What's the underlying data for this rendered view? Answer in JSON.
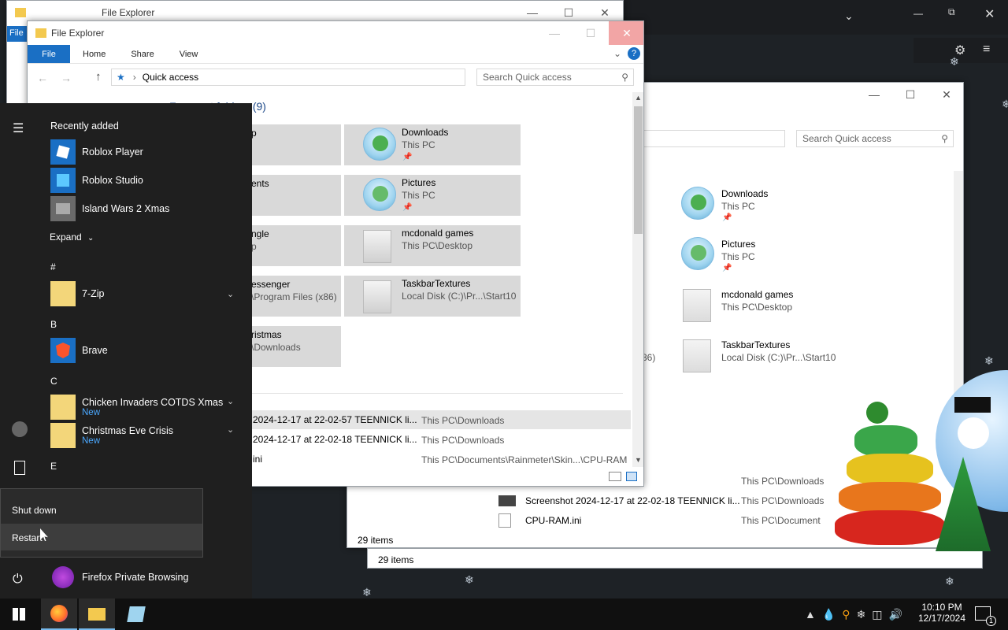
{
  "back_window": {
    "title": "File Explorer",
    "tab_label": "File",
    "status": "29 items"
  },
  "win3": {
    "search_placeholder": "Search Quick access",
    "status": "29 items",
    "tiles": [
      {
        "name": "Downloads",
        "location": "This PC"
      },
      {
        "name": "Pictures",
        "location": "This PC"
      },
      {
        "name": "mcdonald games",
        "location": "This PC\\Desktop"
      },
      {
        "name": "TaskbarTextures",
        "location": "Local Disk (C:)\\Pr...\\Start10"
      }
    ],
    "partial_text": "86)",
    "recent": [
      {
        "name": "2-57 TEENNICK li...",
        "path": "This PC\\Downloads"
      },
      {
        "name": "Screenshot 2024-12-17 at 22-02-18 TEENNICK li...",
        "path": "This PC\\Downloads"
      },
      {
        "name": "CPU-RAM.ini",
        "path": "This PC\\Document"
      }
    ]
  },
  "win2": {
    "status": "29 items"
  },
  "front": {
    "title": "File Explorer",
    "tabs": {
      "file": "File",
      "home": "Home",
      "share": "Share",
      "view": "View"
    },
    "address": "Quick access",
    "search_placeholder": "Search Quick access",
    "section_title": "Frequent folders (9)",
    "tiles_left": [
      {
        "name": "p",
        "location": ""
      },
      {
        "name": "ents",
        "location": ""
      },
      {
        "name": "ngle",
        "location": "p"
      },
      {
        "name": "essenger",
        "location": "\\Program Files (x86)"
      },
      {
        "name": "ristmas",
        "location": "\\Downloads"
      }
    ],
    "tiles_right": [
      {
        "name": "Downloads",
        "location": "This PC"
      },
      {
        "name": "Pictures",
        "location": "This PC"
      },
      {
        "name": "mcdonald games",
        "location": "This PC\\Desktop"
      },
      {
        "name": "TaskbarTextures",
        "location": "Local Disk (C:)\\Pr...\\Start10"
      }
    ],
    "recent": [
      {
        "name": "2024-12-17 at 22-02-57 TEENNICK li...",
        "path": "This PC\\Downloads"
      },
      {
        "name": "2024-12-17 at 22-02-18 TEENNICK li...",
        "path": "This PC\\Downloads"
      },
      {
        "name": "ini",
        "path": "This PC\\Documents\\Rainmeter\\Skin...\\CPU-RAM"
      }
    ]
  },
  "start_menu": {
    "recently_added": "Recently added",
    "apps_recent": [
      {
        "label": "Roblox Player"
      },
      {
        "label": "Roblox Studio"
      },
      {
        "label": "Island Wars 2 Xmas"
      }
    ],
    "expand": "Expand",
    "letters": [
      "#",
      "B",
      "C",
      "E"
    ],
    "apps": {
      "zip": "7-Zip",
      "brave": "Brave",
      "chicken": "Chicken Invaders COTDS Xmas",
      "christmas": "Christmas Eve Crisis",
      "new_badge": "New",
      "firefox_private": "Firefox Private Browsing"
    },
    "power_menu": {
      "shutdown": "Shut down",
      "restart": "Restart"
    }
  },
  "taskbar": {
    "time": "10:10 PM",
    "date": "12/17/2024",
    "notifications": "1"
  },
  "colors": {
    "accent": "#1a6fc4",
    "start_bg": "#1f1f1f",
    "taskbar_bg": "#101010",
    "tile_bg": "#d9d9d9"
  }
}
